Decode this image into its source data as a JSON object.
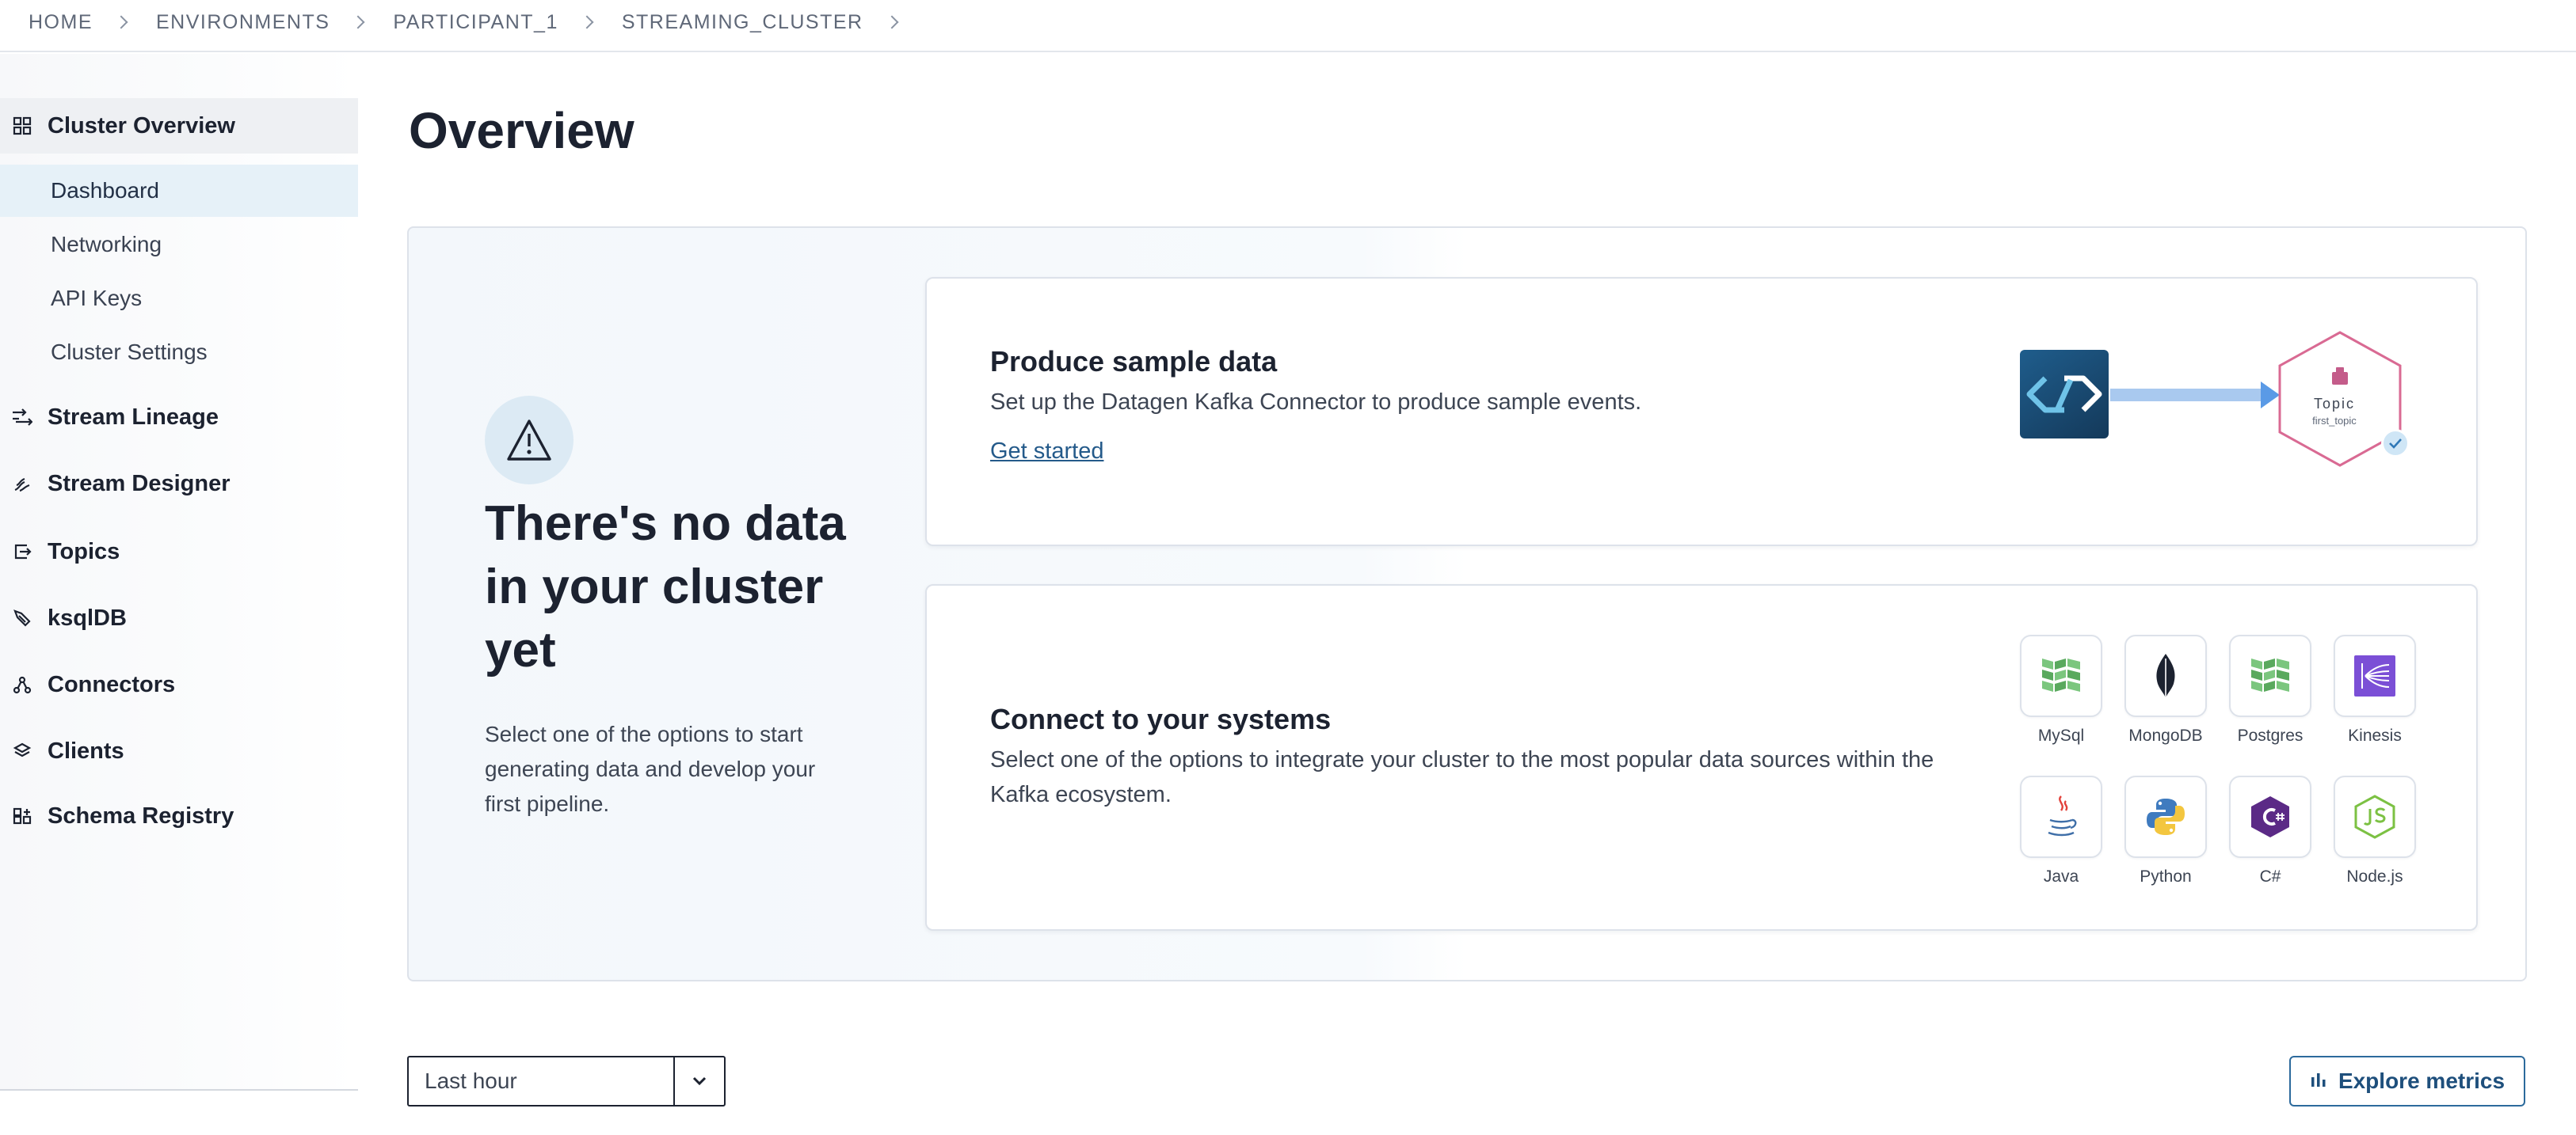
{
  "breadcrumb": [
    "HOME",
    "ENVIRONMENTS",
    "PARTICIPANT_1",
    "STREAMING_CLUSTER"
  ],
  "sidebar": {
    "cluster_overview": "Cluster Overview",
    "sub_items": [
      "Dashboard",
      "Networking",
      "API Keys",
      "Cluster Settings"
    ],
    "sections": [
      "Stream Lineage",
      "Stream Designer",
      "Topics",
      "ksqlDB",
      "Connectors",
      "Clients",
      "Schema Registry"
    ]
  },
  "main": {
    "title": "Overview",
    "empty_state": {
      "title": "There's no data in your cluster yet",
      "description": "Select one of the options to start generating data and develop your first pipeline."
    },
    "produce_card": {
      "title": "Produce sample data",
      "description": "Set up the Datagen Kafka Connector to produce sample events.",
      "link": "Get started",
      "topic_label": "Topic",
      "topic_name": "first_topic"
    },
    "connect_card": {
      "title": "Connect to your systems",
      "description": "Select one of the options to integrate your cluster to the most popular data sources within the Kafka ecosystem.",
      "tiles": [
        "MySql",
        "MongoDB",
        "Postgres",
        "Kinesis",
        "Java",
        "Python",
        "C#",
        "Node.js"
      ]
    }
  },
  "controls": {
    "time_range": "Last hour",
    "explore_button": "Explore metrics"
  },
  "colors": {
    "accent": "#245a8a",
    "selected_bg": "#e6f1f8"
  }
}
